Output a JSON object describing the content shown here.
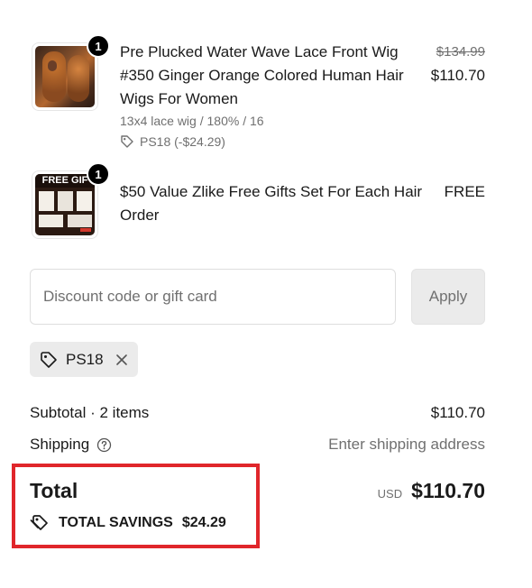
{
  "items": [
    {
      "quantity": "1",
      "title": "Pre Plucked Water Wave Lace Front Wig #350 Ginger Orange Colored Human Hair Wigs For Women",
      "variant": "13x4 lace wig / 180% / 16",
      "discount_tag": "PS18 (-$24.29)",
      "original_price": "$134.99",
      "price": "$110.70"
    },
    {
      "quantity": "1",
      "title": "$50 Value Zlike Free Gifts Set For Each Hair Order",
      "price": "FREE",
      "thumb_caption": "FREE GIF"
    }
  ],
  "discount": {
    "placeholder": "Discount code or gift card",
    "apply_label": "Apply",
    "applied_code": "PS18"
  },
  "summary": {
    "subtotal_label": "Subtotal · 2 items",
    "subtotal_value": "$110.70",
    "shipping_label": "Shipping",
    "shipping_value": "Enter shipping address",
    "total_label": "Total",
    "currency": "USD",
    "total_value": "$110.70",
    "savings_label": "TOTAL SAVINGS",
    "savings_value": "$24.29"
  },
  "colors": {
    "highlight_border": "#e0262b",
    "badge_bg": "#000000"
  }
}
